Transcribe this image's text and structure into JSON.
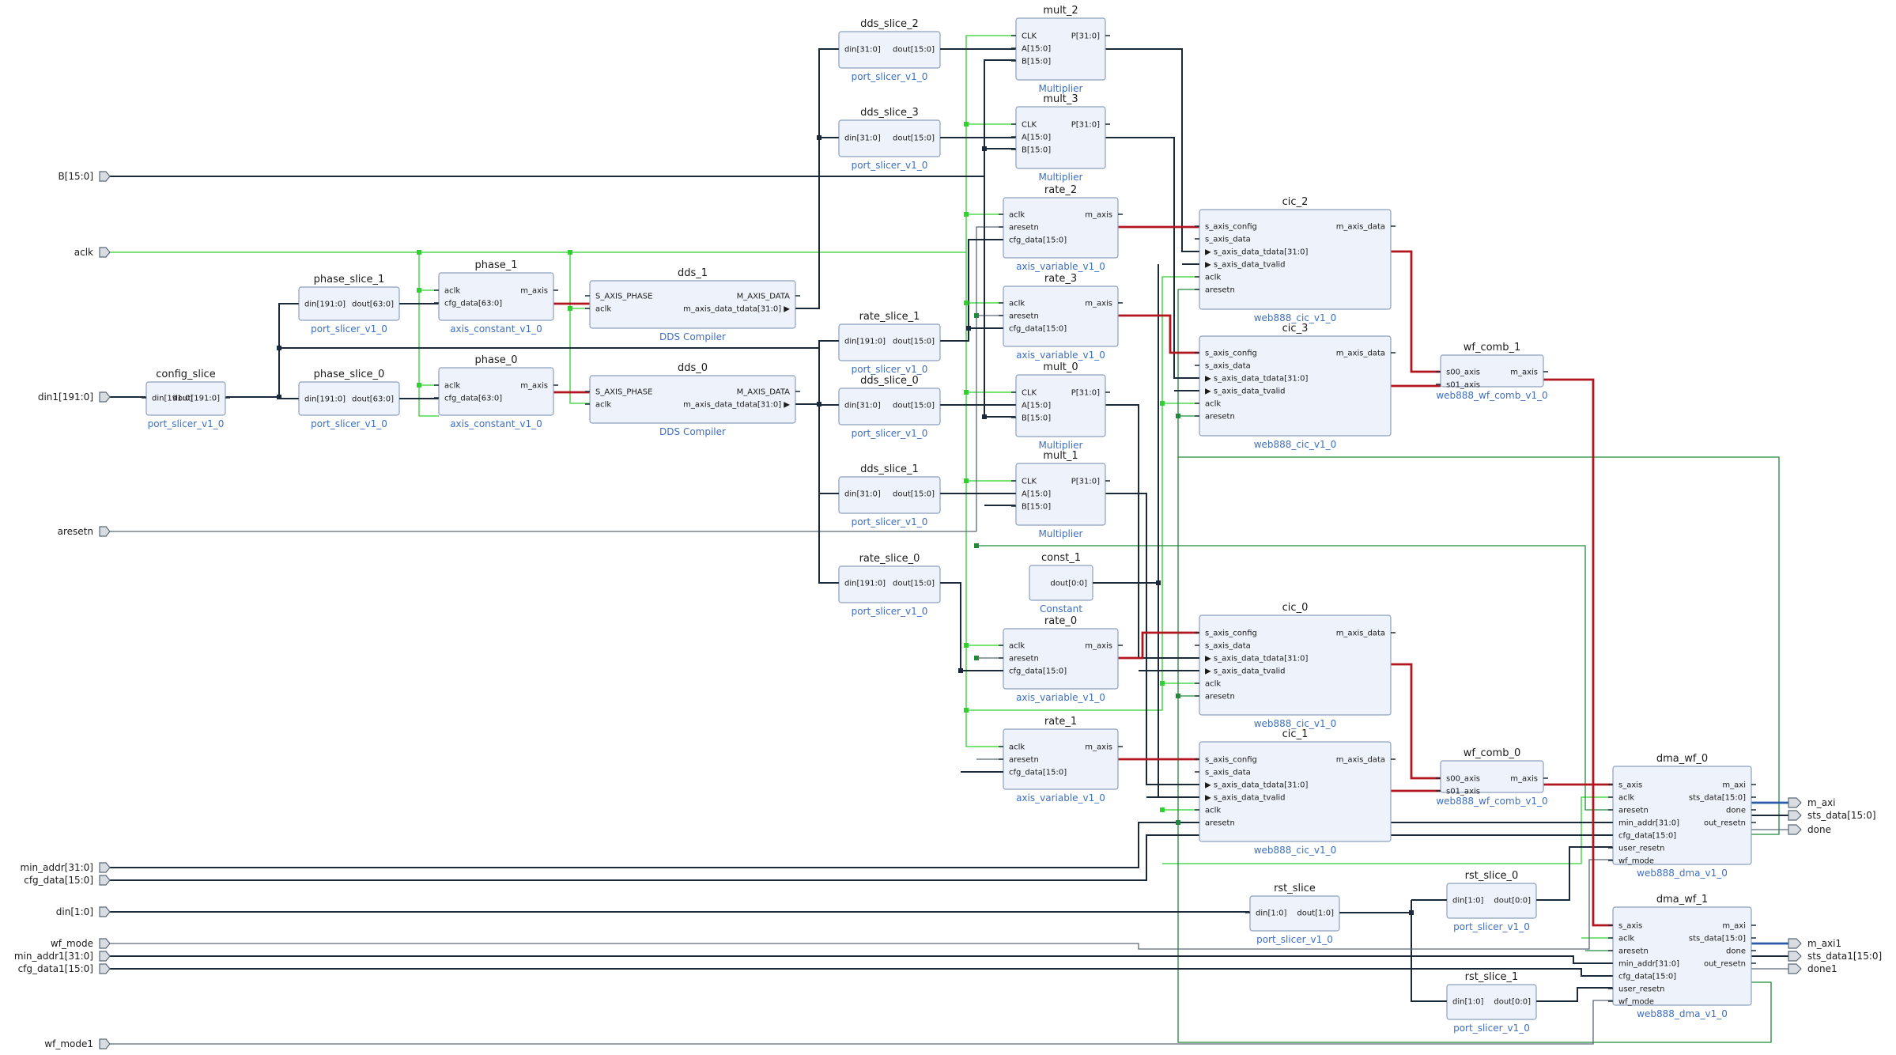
{
  "colors": {
    "block_fill": "#eef3fb",
    "block_stroke": "#8c9fbd",
    "type_label": "#3d6fc0",
    "net_clock": "#2fd02f",
    "net_reset": "#1f8a3a",
    "net_bus": "#1b2a3a",
    "net_axis": "#b3151f",
    "net_axi": "#2a5aa8"
  },
  "ports": [
    {
      "id": "p_b",
      "label": "B[15:0]",
      "side": "in"
    },
    {
      "id": "p_aclk",
      "label": "aclk",
      "side": "in"
    },
    {
      "id": "p_din1",
      "label": "din1[191:0]",
      "side": "in"
    },
    {
      "id": "p_aresetn",
      "label": "aresetn",
      "side": "in"
    },
    {
      "id": "p_min_addr",
      "label": "min_addr[31:0]",
      "side": "in"
    },
    {
      "id": "p_cfg_data",
      "label": "cfg_data[15:0]",
      "side": "in"
    },
    {
      "id": "p_din",
      "label": "din[1:0]",
      "side": "in"
    },
    {
      "id": "p_wf_mode",
      "label": "wf_mode",
      "side": "in"
    },
    {
      "id": "p_min_addr1",
      "label": "min_addr1[31:0]",
      "side": "in"
    },
    {
      "id": "p_cfg_data1",
      "label": "cfg_data1[15:0]",
      "side": "in"
    },
    {
      "id": "p_wf_mode1",
      "label": "wf_mode1",
      "side": "in"
    },
    {
      "id": "p_m_axi",
      "label": "m_axi",
      "side": "out"
    },
    {
      "id": "p_sts_data",
      "label": "sts_data[15:0]",
      "side": "out"
    },
    {
      "id": "p_done",
      "label": "done",
      "side": "out"
    },
    {
      "id": "p_m_axi1",
      "label": "m_axi1",
      "side": "out"
    },
    {
      "id": "p_sts_data1",
      "label": "sts_data1[15:0]",
      "side": "out"
    },
    {
      "id": "p_done1",
      "label": "done1",
      "side": "out"
    }
  ],
  "blocks": [
    {
      "id": "config_slice",
      "name": "config_slice",
      "type": "port_slicer_v1_0",
      "left_pins": [
        "din[191:0]"
      ],
      "right_pins": [
        "dout[191:0]"
      ]
    },
    {
      "id": "phase_slice_1",
      "name": "phase_slice_1",
      "type": "port_slicer_v1_0",
      "left_pins": [
        "din[191:0]"
      ],
      "right_pins": [
        "dout[63:0]"
      ]
    },
    {
      "id": "phase_slice_0",
      "name": "phase_slice_0",
      "type": "port_slicer_v1_0",
      "left_pins": [
        "din[191:0]"
      ],
      "right_pins": [
        "dout[63:0]"
      ]
    },
    {
      "id": "phase_1",
      "name": "phase_1",
      "type": "axis_constant_v1_0",
      "left_pins": [
        "aclk",
        "cfg_data[63:0]"
      ],
      "right_pins": [
        "m_axis"
      ]
    },
    {
      "id": "phase_0",
      "name": "phase_0",
      "type": "axis_constant_v1_0",
      "left_pins": [
        "aclk",
        "cfg_data[63:0]"
      ],
      "right_pins": [
        "m_axis"
      ]
    },
    {
      "id": "dds_1",
      "name": "dds_1",
      "type": "DDS Compiler",
      "left_pins": [
        "S_AXIS_PHASE",
        "aclk"
      ],
      "right_pins": [
        "M_AXIS_DATA",
        "m_axis_data_tdata[31:0] ▶"
      ]
    },
    {
      "id": "dds_0",
      "name": "dds_0",
      "type": "DDS Compiler",
      "left_pins": [
        "S_AXIS_PHASE",
        "aclk"
      ],
      "right_pins": [
        "M_AXIS_DATA",
        "m_axis_data_tdata[31:0] ▶"
      ]
    },
    {
      "id": "dds_slice_2",
      "name": "dds_slice_2",
      "type": "port_slicer_v1_0",
      "left_pins": [
        "din[31:0]"
      ],
      "right_pins": [
        "dout[15:0]"
      ]
    },
    {
      "id": "dds_slice_3",
      "name": "dds_slice_3",
      "type": "port_slicer_v1_0",
      "left_pins": [
        "din[31:0]"
      ],
      "right_pins": [
        "dout[15:0]"
      ]
    },
    {
      "id": "rate_slice_1",
      "name": "rate_slice_1",
      "type": "port_slicer_v1_0",
      "left_pins": [
        "din[191:0]"
      ],
      "right_pins": [
        "dout[15:0]"
      ]
    },
    {
      "id": "dds_slice_0",
      "name": "dds_slice_0",
      "type": "port_slicer_v1_0",
      "left_pins": [
        "din[31:0]"
      ],
      "right_pins": [
        "dout[15:0]"
      ]
    },
    {
      "id": "dds_slice_1",
      "name": "dds_slice_1",
      "type": "port_slicer_v1_0",
      "left_pins": [
        "din[31:0]"
      ],
      "right_pins": [
        "dout[15:0]"
      ]
    },
    {
      "id": "rate_slice_0",
      "name": "rate_slice_0",
      "type": "port_slicer_v1_0",
      "left_pins": [
        "din[191:0]"
      ],
      "right_pins": [
        "dout[15:0]"
      ]
    },
    {
      "id": "mult_2",
      "name": "mult_2",
      "type": "Multiplier",
      "left_pins": [
        "CLK",
        "A[15:0]",
        "B[15:0]"
      ],
      "right_pins": [
        "P[31:0]"
      ]
    },
    {
      "id": "mult_3",
      "name": "mult_3",
      "type": "Multiplier",
      "left_pins": [
        "CLK",
        "A[15:0]",
        "B[15:0]"
      ],
      "right_pins": [
        "P[31:0]"
      ]
    },
    {
      "id": "mult_0",
      "name": "mult_0",
      "type": "Multiplier",
      "left_pins": [
        "CLK",
        "A[15:0]",
        "B[15:0]"
      ],
      "right_pins": [
        "P[31:0]"
      ]
    },
    {
      "id": "mult_1",
      "name": "mult_1",
      "type": "Multiplier",
      "left_pins": [
        "CLK",
        "A[15:0]",
        "B[15:0]"
      ],
      "right_pins": [
        "P[31:0]"
      ]
    },
    {
      "id": "rate_2",
      "name": "rate_2",
      "type": "axis_variable_v1_0",
      "left_pins": [
        "aclk",
        "aresetn",
        "cfg_data[15:0]"
      ],
      "right_pins": [
        "m_axis"
      ]
    },
    {
      "id": "rate_3",
      "name": "rate_3",
      "type": "axis_variable_v1_0",
      "left_pins": [
        "aclk",
        "aresetn",
        "cfg_data[15:0]"
      ],
      "right_pins": [
        "m_axis"
      ]
    },
    {
      "id": "const_1",
      "name": "const_1",
      "type": "Constant",
      "left_pins": [],
      "right_pins": [
        "dout[0:0]"
      ]
    },
    {
      "id": "rate_0",
      "name": "rate_0",
      "type": "axis_variable_v1_0",
      "left_pins": [
        "aclk",
        "aresetn",
        "cfg_data[15:0]"
      ],
      "right_pins": [
        "m_axis"
      ]
    },
    {
      "id": "rate_1",
      "name": "rate_1",
      "type": "axis_variable_v1_0",
      "left_pins": [
        "aclk",
        "aresetn",
        "cfg_data[15:0]"
      ],
      "right_pins": [
        "m_axis"
      ]
    },
    {
      "id": "cic_2",
      "name": "cic_2",
      "type": "web888_cic_v1_0",
      "left_pins": [
        "s_axis_config",
        "s_axis_data",
        "▶ s_axis_data_tdata[31:0]",
        "▶ s_axis_data_tvalid",
        "aclk",
        "aresetn"
      ],
      "right_pins": [
        "m_axis_data"
      ]
    },
    {
      "id": "cic_3",
      "name": "cic_3",
      "type": "web888_cic_v1_0",
      "left_pins": [
        "s_axis_config",
        "s_axis_data",
        "▶ s_axis_data_tdata[31:0]",
        "▶ s_axis_data_tvalid",
        "aclk",
        "aresetn"
      ],
      "right_pins": [
        "m_axis_data"
      ]
    },
    {
      "id": "cic_0",
      "name": "cic_0",
      "type": "web888_cic_v1_0",
      "left_pins": [
        "s_axis_config",
        "s_axis_data",
        "▶ s_axis_data_tdata[31:0]",
        "▶ s_axis_data_tvalid",
        "aclk",
        "aresetn"
      ],
      "right_pins": [
        "m_axis_data"
      ]
    },
    {
      "id": "cic_1",
      "name": "cic_1",
      "type": "web888_cic_v1_0",
      "left_pins": [
        "s_axis_config",
        "s_axis_data",
        "▶ s_axis_data_tdata[31:0]",
        "▶ s_axis_data_tvalid",
        "aclk",
        "aresetn"
      ],
      "right_pins": [
        "m_axis_data"
      ]
    },
    {
      "id": "wf_comb_1",
      "name": "wf_comb_1",
      "type": "web888_wf_comb_v1_0",
      "left_pins": [
        "s00_axis",
        "s01_axis"
      ],
      "right_pins": [
        "m_axis"
      ]
    },
    {
      "id": "wf_comb_0",
      "name": "wf_comb_0",
      "type": "web888_wf_comb_v1_0",
      "left_pins": [
        "s00_axis",
        "s01_axis"
      ],
      "right_pins": [
        "m_axis"
      ]
    },
    {
      "id": "rst_slice",
      "name": "rst_slice",
      "type": "port_slicer_v1_0",
      "left_pins": [
        "din[1:0]"
      ],
      "right_pins": [
        "dout[1:0]"
      ]
    },
    {
      "id": "rst_slice_0",
      "name": "rst_slice_0",
      "type": "port_slicer_v1_0",
      "left_pins": [
        "din[1:0]"
      ],
      "right_pins": [
        "dout[0:0]"
      ]
    },
    {
      "id": "rst_slice_1",
      "name": "rst_slice_1",
      "type": "port_slicer_v1_0",
      "left_pins": [
        "din[1:0]"
      ],
      "right_pins": [
        "dout[0:0]"
      ]
    },
    {
      "id": "dma_wf_0",
      "name": "dma_wf_0",
      "type": "web888_dma_v1_0",
      "left_pins": [
        "s_axis",
        "aclk",
        "aresetn",
        "min_addr[31:0]",
        "cfg_data[15:0]",
        "user_resetn",
        "wf_mode"
      ],
      "right_pins": [
        "m_axi",
        "sts_data[15:0]",
        "done",
        "out_resetn"
      ]
    },
    {
      "id": "dma_wf_1",
      "name": "dma_wf_1",
      "type": "web888_dma_v1_0",
      "left_pins": [
        "s_axis",
        "aclk",
        "aresetn",
        "min_addr[31:0]",
        "cfg_data[15:0]",
        "user_resetn",
        "wf_mode"
      ],
      "right_pins": [
        "m_axi",
        "sts_data[15:0]",
        "done",
        "out_resetn"
      ]
    }
  ]
}
